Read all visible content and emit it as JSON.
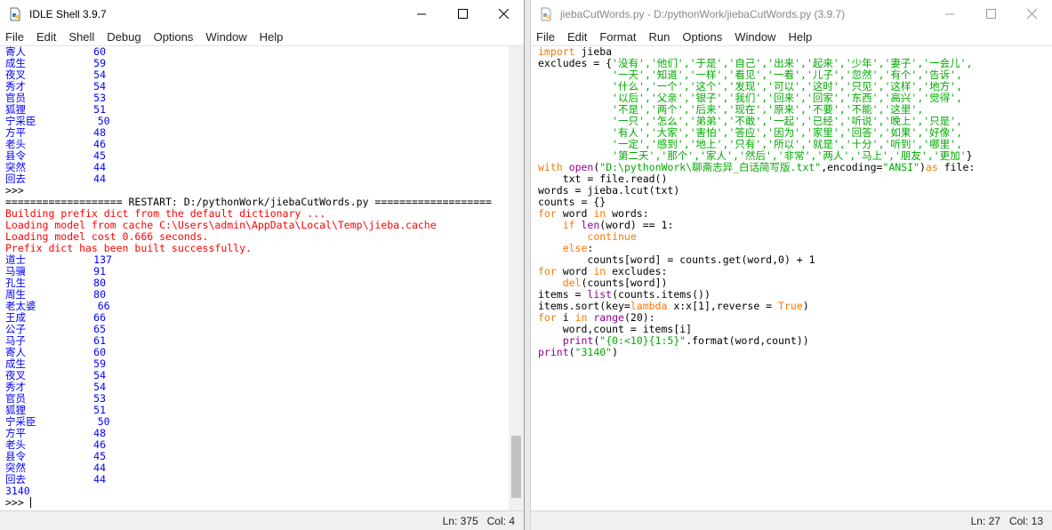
{
  "shell": {
    "title": "IDLE Shell 3.9.7",
    "menu": [
      "File",
      "Edit",
      "Shell",
      "Debug",
      "Options",
      "Window",
      "Help"
    ],
    "lines": [
      {
        "text": "寄人           60",
        "cls": "blue"
      },
      {
        "text": "成生           59",
        "cls": "blue"
      },
      {
        "text": "夜叉           54",
        "cls": "blue"
      },
      {
        "text": "秀才           54",
        "cls": "blue"
      },
      {
        "text": "官员           53",
        "cls": "blue"
      },
      {
        "text": "狐狸           51",
        "cls": "blue"
      },
      {
        "text": "宁采臣          50",
        "cls": "blue"
      },
      {
        "text": "方平           48",
        "cls": "blue"
      },
      {
        "text": "老头           46",
        "cls": "blue"
      },
      {
        "text": "县令           45",
        "cls": "blue"
      },
      {
        "text": "突然           44",
        "cls": "blue"
      },
      {
        "text": "回去           44",
        "cls": "blue"
      },
      {
        "text": ">>> ",
        "cls": ""
      },
      {
        "text": "=================== RESTART: D:/pythonWork/jiebaCutWords.py ===================",
        "cls": ""
      },
      {
        "text": "Building prefix dict from the default dictionary ...",
        "cls": "red"
      },
      {
        "text": "Loading model from cache C:\\Users\\admin\\AppData\\Local\\Temp\\jieba.cache",
        "cls": "red"
      },
      {
        "text": "Loading model cost 0.666 seconds.",
        "cls": "red"
      },
      {
        "text": "Prefix dict has been built successfully.",
        "cls": "red"
      },
      {
        "text": "道士           137",
        "cls": "blue"
      },
      {
        "text": "马骥           91",
        "cls": "blue"
      },
      {
        "text": "孔生           80",
        "cls": "blue"
      },
      {
        "text": "周生           80",
        "cls": "blue"
      },
      {
        "text": "老太婆          66",
        "cls": "blue"
      },
      {
        "text": "王成           66",
        "cls": "blue"
      },
      {
        "text": "公子           65",
        "cls": "blue"
      },
      {
        "text": "马子           61",
        "cls": "blue"
      },
      {
        "text": "寄人           60",
        "cls": "blue"
      },
      {
        "text": "成生           59",
        "cls": "blue"
      },
      {
        "text": "夜叉           54",
        "cls": "blue"
      },
      {
        "text": "秀才           54",
        "cls": "blue"
      },
      {
        "text": "官员           53",
        "cls": "blue"
      },
      {
        "text": "狐狸           51",
        "cls": "blue"
      },
      {
        "text": "宁采臣          50",
        "cls": "blue"
      },
      {
        "text": "方平           48",
        "cls": "blue"
      },
      {
        "text": "老头           46",
        "cls": "blue"
      },
      {
        "text": "县令           45",
        "cls": "blue"
      },
      {
        "text": "突然           44",
        "cls": "blue"
      },
      {
        "text": "回去           44",
        "cls": "blue"
      },
      {
        "text": "3140",
        "cls": "blue"
      }
    ],
    "prompt": ">>> ",
    "status": {
      "ln": "Ln: 375",
      "col": "Col: 4"
    }
  },
  "editor": {
    "title": "jiebaCutWords.py - D:/pythonWork/jiebaCutWords.py (3.9.7)",
    "menu": [
      "File",
      "Edit",
      "Format",
      "Run",
      "Options",
      "Window",
      "Help"
    ],
    "lines": [
      [
        {
          "t": "import",
          "c": "kw"
        },
        {
          "t": " jieba",
          "c": ""
        }
      ],
      [
        {
          "t": "excludes = {",
          "c": ""
        },
        {
          "t": "'没有','他们','于是','自己','出来','起来','少年','妻子','一会儿',",
          "c": "str"
        }
      ],
      [
        {
          "t": "            ",
          "c": ""
        },
        {
          "t": "'一天','知道','一样','看见','一看','儿子','忽然','有个','告诉',",
          "c": "str"
        }
      ],
      [
        {
          "t": "            ",
          "c": ""
        },
        {
          "t": "'什么','一个','这个','发现','可以','这时','只见','这样','地方',",
          "c": "str"
        }
      ],
      [
        {
          "t": "            ",
          "c": ""
        },
        {
          "t": "'以后','父亲','银子','我们','回来','回家','东西','高兴','觉得',",
          "c": "str"
        }
      ],
      [
        {
          "t": "            ",
          "c": ""
        },
        {
          "t": "'不是','两个','后来','现在','原来','不要','不能','这里',",
          "c": "str"
        }
      ],
      [
        {
          "t": "            ",
          "c": ""
        },
        {
          "t": "'一只','怎么','弟弟','不敢','一起','已经','听说','晚上','只是',",
          "c": "str"
        }
      ],
      [
        {
          "t": "            ",
          "c": ""
        },
        {
          "t": "'有人','大家','害怕','答应','因为','家里','回答','如果','好像',",
          "c": "str"
        }
      ],
      [
        {
          "t": "            ",
          "c": ""
        },
        {
          "t": "'一定','感到','地上','只有','所以','就是','十分','听到','哪里',",
          "c": "str"
        }
      ],
      [
        {
          "t": "            ",
          "c": ""
        },
        {
          "t": "'第二天','那个','家人','然后','非常','两人','马上','朋友','更加'",
          "c": "str"
        },
        {
          "t": "}",
          "c": ""
        }
      ],
      [
        {
          "t": "with",
          "c": "kw"
        },
        {
          "t": " ",
          "c": ""
        },
        {
          "t": "open",
          "c": "bi"
        },
        {
          "t": "(",
          "c": ""
        },
        {
          "t": "\"D:\\pythonWork\\聊斋志异_白话简写版.txt\"",
          "c": "str"
        },
        {
          "t": ",encoding=",
          "c": ""
        },
        {
          "t": "\"ANSI\"",
          "c": "str"
        },
        {
          "t": ")",
          "c": ""
        },
        {
          "t": "as",
          "c": "kw"
        },
        {
          "t": " file:",
          "c": ""
        }
      ],
      [
        {
          "t": "    txt = file.read()",
          "c": ""
        }
      ],
      [
        {
          "t": "words = jieba.lcut(txt)",
          "c": ""
        }
      ],
      [
        {
          "t": "counts = {}",
          "c": ""
        }
      ],
      [
        {
          "t": "for",
          "c": "kw"
        },
        {
          "t": " word ",
          "c": ""
        },
        {
          "t": "in",
          "c": "kw"
        },
        {
          "t": " words:",
          "c": ""
        }
      ],
      [
        {
          "t": "    ",
          "c": ""
        },
        {
          "t": "if",
          "c": "kw"
        },
        {
          "t": " ",
          "c": ""
        },
        {
          "t": "len",
          "c": "bi"
        },
        {
          "t": "(word) == 1:",
          "c": ""
        }
      ],
      [
        {
          "t": "        ",
          "c": ""
        },
        {
          "t": "continue",
          "c": "kw"
        }
      ],
      [
        {
          "t": "    ",
          "c": ""
        },
        {
          "t": "else",
          "c": "kw"
        },
        {
          "t": ":",
          "c": ""
        }
      ],
      [
        {
          "t": "        counts[word] = counts.get(word,0) + 1",
          "c": ""
        }
      ],
      [
        {
          "t": "for",
          "c": "kw"
        },
        {
          "t": " word ",
          "c": ""
        },
        {
          "t": "in",
          "c": "kw"
        },
        {
          "t": " excludes:",
          "c": ""
        }
      ],
      [
        {
          "t": "    ",
          "c": ""
        },
        {
          "t": "del",
          "c": "kw"
        },
        {
          "t": "(counts[word])",
          "c": ""
        }
      ],
      [
        {
          "t": "items = ",
          "c": ""
        },
        {
          "t": "list",
          "c": "bi"
        },
        {
          "t": "(counts.items())",
          "c": ""
        }
      ],
      [
        {
          "t": "items.sort(key=",
          "c": ""
        },
        {
          "t": "lambda",
          "c": "kw"
        },
        {
          "t": " x:x[1],reverse = ",
          "c": ""
        },
        {
          "t": "True",
          "c": "kw"
        },
        {
          "t": ")",
          "c": ""
        }
      ],
      [
        {
          "t": "for",
          "c": "kw"
        },
        {
          "t": " i ",
          "c": ""
        },
        {
          "t": "in",
          "c": "kw"
        },
        {
          "t": " ",
          "c": ""
        },
        {
          "t": "range",
          "c": "bi"
        },
        {
          "t": "(20):",
          "c": ""
        }
      ],
      [
        {
          "t": "    word,count = items[i]",
          "c": ""
        }
      ],
      [
        {
          "t": "    ",
          "c": ""
        },
        {
          "t": "print",
          "c": "bi"
        },
        {
          "t": "(",
          "c": ""
        },
        {
          "t": "\"{0:<10}{1:5}\"",
          "c": "str"
        },
        {
          "t": ".format(word,count))",
          "c": ""
        }
      ],
      [
        {
          "t": "print",
          "c": "bi"
        },
        {
          "t": "(",
          "c": ""
        },
        {
          "t": "\"3140\"",
          "c": "str"
        },
        {
          "t": ")",
          "c": ""
        }
      ]
    ],
    "status": {
      "ln": "Ln: 27",
      "col": "Col: 13"
    }
  },
  "icons": {
    "app": "idle-icon",
    "minimize": "minimize-icon",
    "maximize": "maximize-icon",
    "close": "close-icon"
  }
}
